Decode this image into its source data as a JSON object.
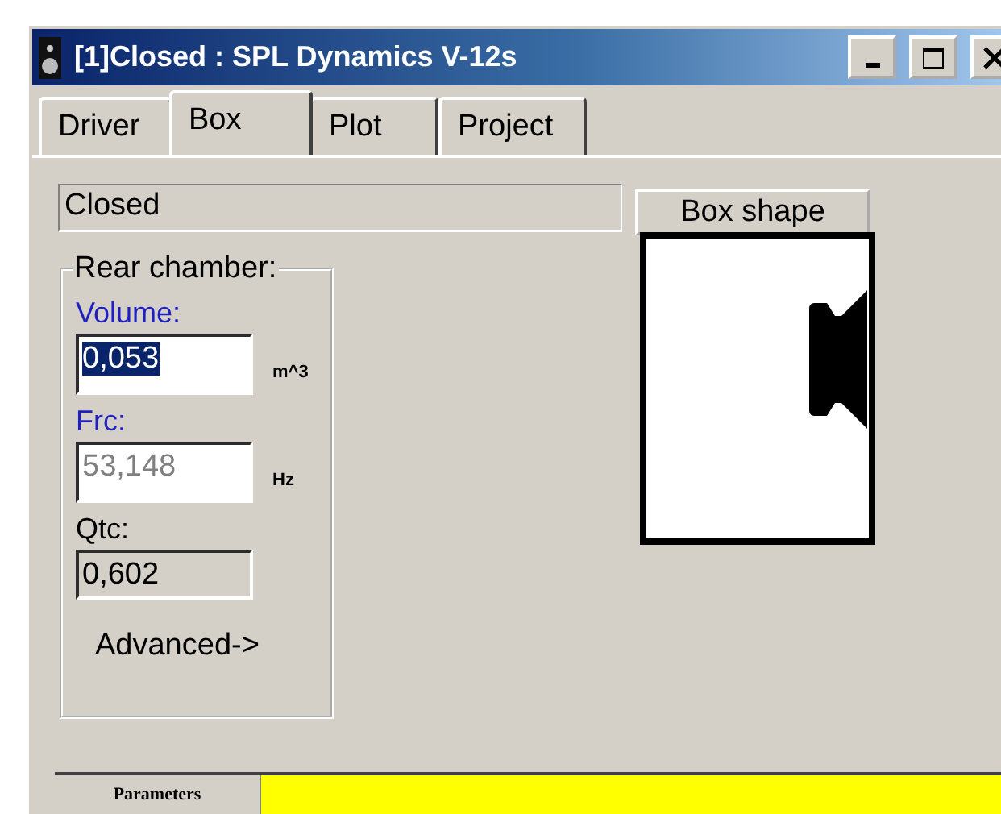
{
  "window": {
    "title": "[1]Closed : SPL Dynamics V-12s"
  },
  "tabs": [
    {
      "label": "Driver",
      "selected": false
    },
    {
      "label": "Box",
      "selected": true
    },
    {
      "label": "Plot",
      "selected": false
    },
    {
      "label": "Project",
      "selected": false
    }
  ],
  "box_type": {
    "value": "Closed"
  },
  "box_shape_button": "Box shape",
  "rear_chamber": {
    "title": "Rear chamber:",
    "fields": [
      {
        "label": "Volume:",
        "value": "0,053",
        "unit": "m^3",
        "kind": "editable",
        "selected": true
      },
      {
        "label": "Frc:",
        "value": "53,148",
        "unit": "Hz",
        "kind": "disabled",
        "selected": false
      },
      {
        "label": "Qtc:",
        "value": "0,602",
        "kind": "readonly",
        "selected": false
      }
    ]
  },
  "advanced_button": "Advanced->",
  "status_bar": {
    "tab": "Parameters"
  }
}
